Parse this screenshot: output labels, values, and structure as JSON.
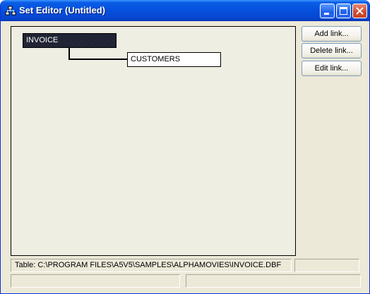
{
  "window": {
    "title": "Set Editor (Untitled)"
  },
  "diagram": {
    "parent_table": "INVOICE",
    "child_table": "CUSTOMERS"
  },
  "buttons": {
    "add_link": "Add link...",
    "delete_link": "Delete link...",
    "edit_link": "Edit link..."
  },
  "status": {
    "table_path": "Table: C:\\PROGRAM FILES\\A5V5\\SAMPLES\\ALPHAMOVIES\\INVOICE.DBF",
    "field_right": "",
    "bottom_left": "",
    "bottom_right": ""
  },
  "colors": {
    "title_bar": "#0550dc",
    "selected_table": "#1c2030",
    "window_face": "#ece9d8"
  }
}
